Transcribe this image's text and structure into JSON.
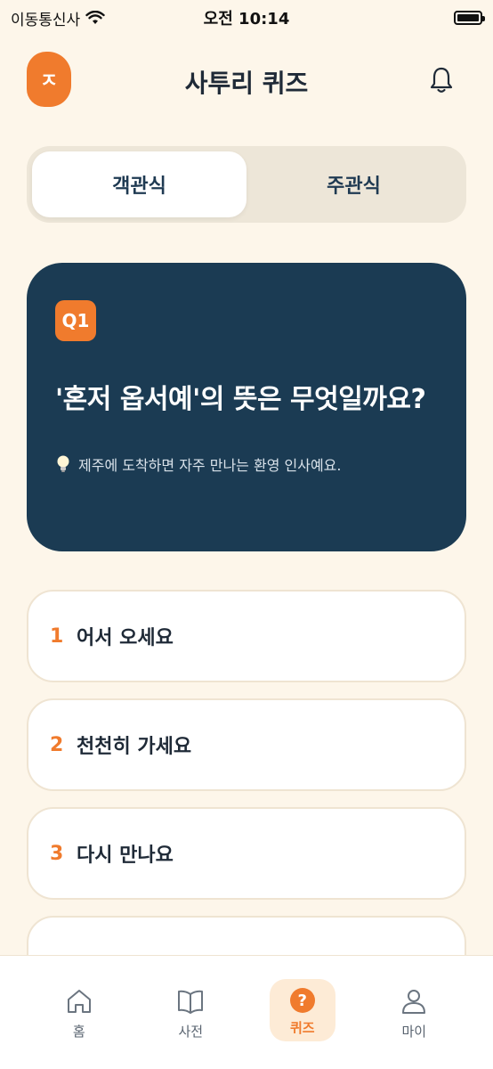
{
  "status_bar": {
    "carrier": "이동통신사",
    "time": "오전 10:14"
  },
  "header": {
    "logo_letter": "ㅈ",
    "title": "사투리 퀴즈"
  },
  "segment": {
    "options": [
      "객관식",
      "주관식"
    ],
    "selected": "객관식"
  },
  "question": {
    "badge": "Q1",
    "text": "'혼저 옵서예'의 뜻은 무엇일까요?",
    "hint": "제주에 도착하면 자주 만나는 환영 인사예요."
  },
  "options": [
    {
      "num": "1",
      "label": "어서 오세요"
    },
    {
      "num": "2",
      "label": "천천히 가세요"
    },
    {
      "num": "3",
      "label": "다시 만나요"
    }
  ],
  "bottom_nav": {
    "items": [
      {
        "label": "홈",
        "icon": "home-icon"
      },
      {
        "label": "사전",
        "icon": "book-icon"
      },
      {
        "label": "퀴즈",
        "icon": "quiz-icon"
      },
      {
        "label": "마이",
        "icon": "user-icon"
      }
    ],
    "active": "퀴즈"
  },
  "colors": {
    "accent": "#f07b2d",
    "card_navy": "#1b3b53",
    "background": "#fdf6ea"
  }
}
